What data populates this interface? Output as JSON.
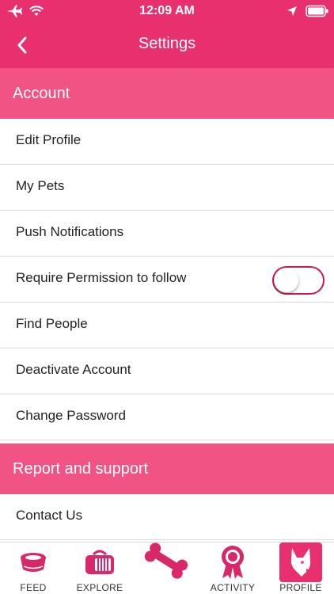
{
  "status_bar": {
    "time": "12:09 AM",
    "icons": [
      "airplane-icon",
      "wifi-icon",
      "location-arrow-icon",
      "battery-icon"
    ]
  },
  "navbar": {
    "title": "Settings",
    "back_icon": "chevron-left-icon"
  },
  "sections": {
    "account": {
      "title": "Account",
      "items": [
        {
          "label": "Edit Profile"
        },
        {
          "label": "My Pets"
        },
        {
          "label": "Push Notifications"
        },
        {
          "label": "Require Permission to follow",
          "toggle": false
        },
        {
          "label": "Find People"
        },
        {
          "label": "Deactivate Account"
        },
        {
          "label": "Change Password"
        }
      ]
    },
    "support": {
      "title": "Report and support",
      "items": [
        {
          "label": "Contact Us"
        }
      ]
    }
  },
  "tabbar": {
    "tabs": [
      {
        "label": "FEED",
        "icon": "pet-bowl-icon"
      },
      {
        "label": "EXPLORE",
        "icon": "pet-carrier-icon"
      },
      {
        "label": "",
        "icon": "bone-icon"
      },
      {
        "label": "ACTIVITY",
        "icon": "award-ribbon-icon"
      },
      {
        "label": "PROFILE",
        "icon": "dog-head-icon",
        "active": true
      }
    ]
  },
  "colors": {
    "primary": "#e8306e",
    "section_header": "#f15484",
    "icon_pink": "#d8286a",
    "divider": "#d9d9d9"
  }
}
